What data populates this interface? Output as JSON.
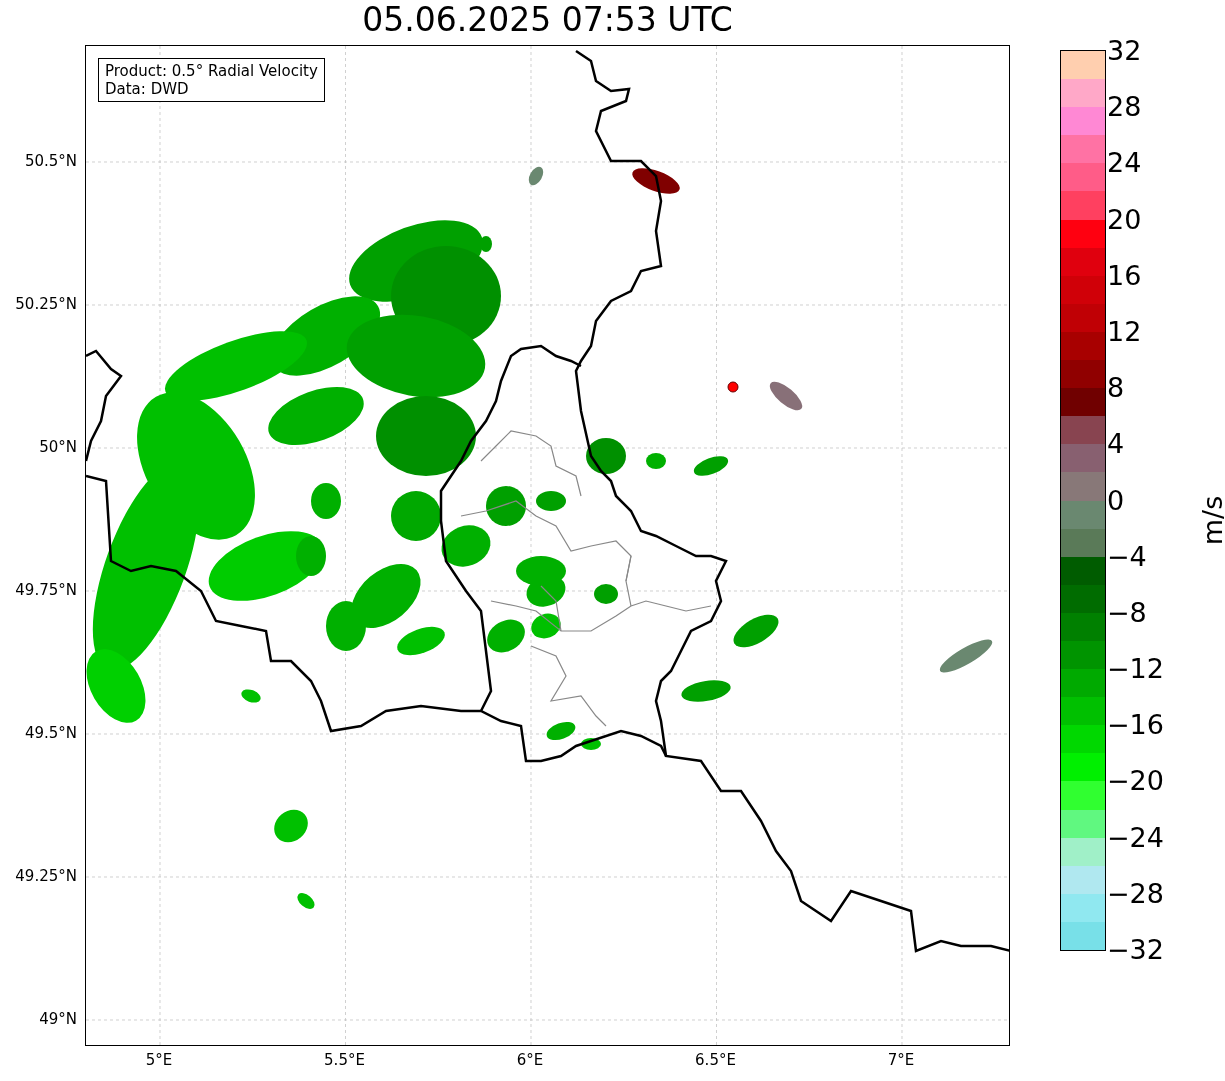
{
  "title": "05.06.2025 07:53 UTC",
  "legend": [
    "Product: 0.5° Radial Velocity",
    "Data: DWD"
  ],
  "map": {
    "y_ticks": [
      "50.5°N",
      "50.25°N",
      "50°N",
      "49.75°N",
      "49.5°N",
      "49.25°N",
      "49°N"
    ],
    "x_ticks": [
      "5°E",
      "5.5°E",
      "6°E",
      "6.5°E",
      "7°E"
    ]
  },
  "colorbar": {
    "label": "m/s",
    "ticks": [
      "32",
      "28",
      "24",
      "20",
      "16",
      "12",
      "8",
      "4",
      "0",
      "−4",
      "−8",
      "−12",
      "−16",
      "−20",
      "−24",
      "−28",
      "−32"
    ],
    "bands": [
      {
        "color": "#ffcfaf"
      },
      {
        "color": "#ffa8c8"
      },
      {
        "color": "#ff88d4"
      },
      {
        "color": "#ff72a4"
      },
      {
        "color": "#ff5c88"
      },
      {
        "color": "#ff4060"
      },
      {
        "color": "#ff0010"
      },
      {
        "color": "#e0000e"
      },
      {
        "color": "#d00008"
      },
      {
        "color": "#c00005"
      },
      {
        "color": "#a80000"
      },
      {
        "color": "#900000"
      },
      {
        "color": "#700000"
      },
      {
        "color": "#884450"
      },
      {
        "color": "#886070"
      },
      {
        "color": "#887878"
      },
      {
        "color": "#6a8870"
      },
      {
        "color": "#5a7a58"
      },
      {
        "color": "#005c00"
      },
      {
        "color": "#006c00"
      },
      {
        "color": "#008000"
      },
      {
        "color": "#009400"
      },
      {
        "color": "#00aa00"
      },
      {
        "color": "#00c000"
      },
      {
        "color": "#00d800"
      },
      {
        "color": "#00f000"
      },
      {
        "color": "#30ff30"
      },
      {
        "color": "#60f880"
      },
      {
        "color": "#a0f0c8"
      },
      {
        "color": "#b0e8f0"
      },
      {
        "color": "#90e8f0"
      },
      {
        "color": "#78e0e8"
      }
    ]
  }
}
